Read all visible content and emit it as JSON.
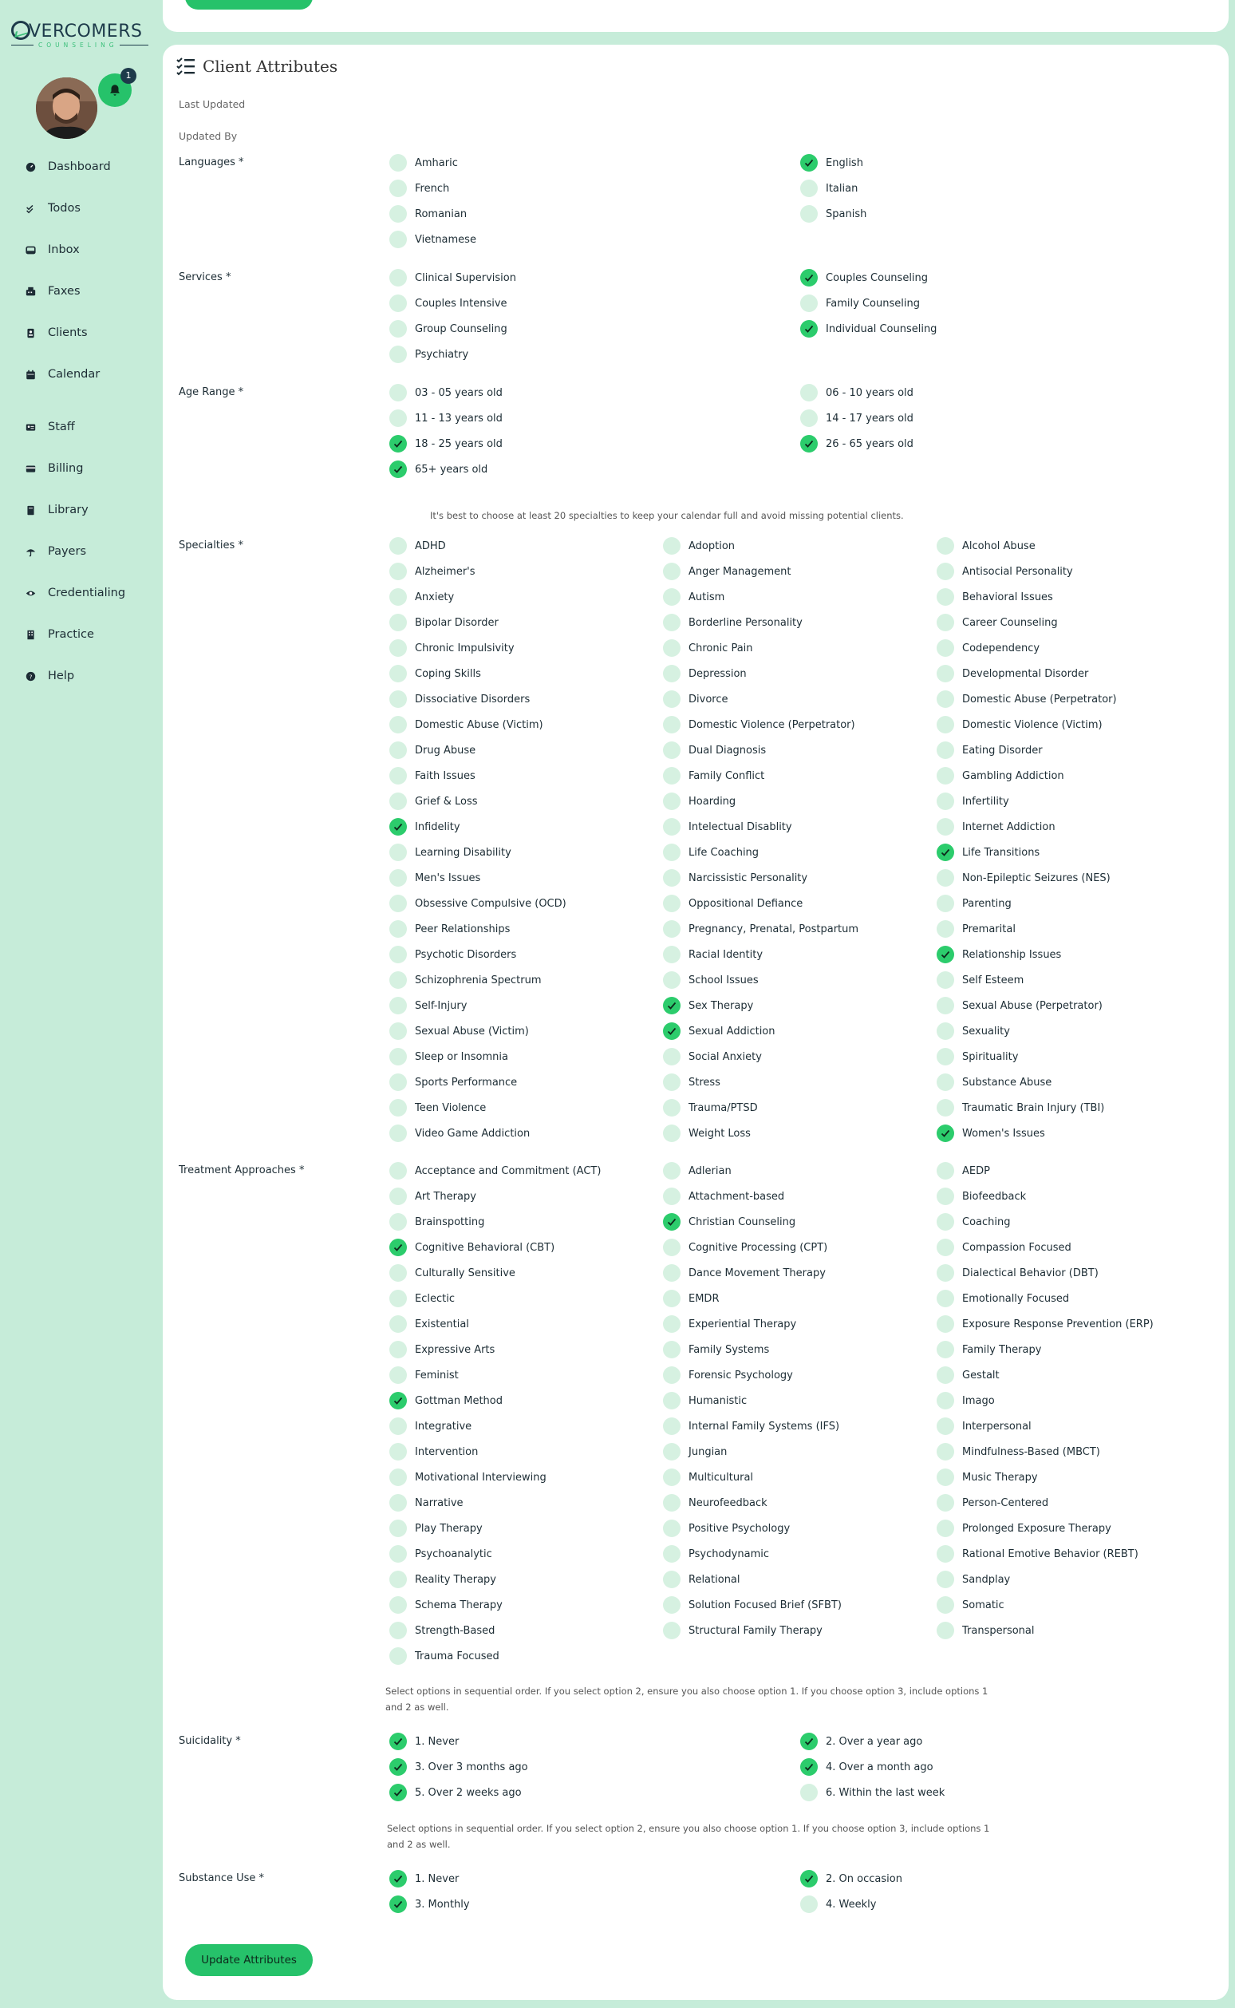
{
  "brand": {
    "logo_main": "VERCOMERS",
    "logo_sub": "COUNSELING"
  },
  "colors": {
    "accent": "#26c26a",
    "background": "#c6ecd9",
    "checkbox_off": "#d6f1e1"
  },
  "notifications": {
    "count": "1"
  },
  "nav": [
    {
      "label": "Dashboard",
      "icon": "dashboard-icon"
    },
    {
      "label": "Todos",
      "icon": "checks-icon"
    },
    {
      "label": "Inbox",
      "icon": "inbox-icon"
    },
    {
      "label": "Faxes",
      "icon": "fax-icon"
    },
    {
      "label": "Clients",
      "icon": "contact-card-icon"
    },
    {
      "label": "Calendar",
      "icon": "calendar-icon"
    },
    {
      "label": "Staff",
      "icon": "id-card-icon"
    },
    {
      "label": "Billing",
      "icon": "billing-icon"
    },
    {
      "label": "Library",
      "icon": "book-icon"
    },
    {
      "label": "Payers",
      "icon": "umbrella-icon"
    },
    {
      "label": "Credentialing",
      "icon": "eye-icon"
    },
    {
      "label": "Practice",
      "icon": "building-icon"
    },
    {
      "label": "Help",
      "icon": "help-icon"
    }
  ],
  "card": {
    "title": "Client Attributes",
    "last_updated_label": "Last Updated",
    "updated_by_label": "Updated By",
    "specialties_hint": "It's best to choose at least 20 specialties to keep your calendar full and avoid missing potential clients.",
    "suicidality_hint_1": "Select options in sequential order. If you select option 2, ensure you also choose option 1. If you choose option 3, include options 1",
    "suicidality_hint_2": "and 2 as well.",
    "substance_hint_1": "Select options in sequential order. If you select option 2, ensure you also choose option 1. If you choose option 3, include options 1",
    "substance_hint_2": "and 2 as well.",
    "update_button": "Update Attributes"
  },
  "sections": [
    {
      "key": "languages",
      "label": "Languages *",
      "cols": 2,
      "options": [
        {
          "label": "Amharic",
          "checked": false
        },
        {
          "label": "English",
          "checked": true
        },
        {
          "label": "French",
          "checked": false
        },
        {
          "label": "Italian",
          "checked": false
        },
        {
          "label": "Romanian",
          "checked": false
        },
        {
          "label": "Spanish",
          "checked": false
        },
        {
          "label": "Vietnamese",
          "checked": false
        }
      ]
    },
    {
      "key": "services",
      "label": "Services *",
      "cols": 2,
      "options": [
        {
          "label": "Clinical Supervision",
          "checked": false
        },
        {
          "label": "Couples Counseling",
          "checked": true
        },
        {
          "label": "Couples Intensive",
          "checked": false
        },
        {
          "label": "Family Counseling",
          "checked": false
        },
        {
          "label": "Group Counseling",
          "checked": false
        },
        {
          "label": "Individual Counseling",
          "checked": true
        },
        {
          "label": "Psychiatry",
          "checked": false
        }
      ]
    },
    {
      "key": "age_range",
      "label": "Age Range *",
      "cols": 2,
      "options": [
        {
          "label": "03 - 05 years old",
          "checked": false
        },
        {
          "label": "06 - 10 years old",
          "checked": false
        },
        {
          "label": "11 - 13 years old",
          "checked": false
        },
        {
          "label": "14 - 17 years old",
          "checked": false
        },
        {
          "label": "18 - 25 years old",
          "checked": true
        },
        {
          "label": "26 - 65 years old",
          "checked": true
        },
        {
          "label": "65+ years old",
          "checked": true
        }
      ]
    },
    {
      "key": "specialties",
      "label": "Specialties *",
      "cols": 3,
      "options": [
        {
          "label": "ADHD",
          "checked": false
        },
        {
          "label": "Adoption",
          "checked": false
        },
        {
          "label": "Alcohol Abuse",
          "checked": false
        },
        {
          "label": "Alzheimer's",
          "checked": false
        },
        {
          "label": "Anger Management",
          "checked": false
        },
        {
          "label": "Antisocial Personality",
          "checked": false
        },
        {
          "label": "Anxiety",
          "checked": false
        },
        {
          "label": "Autism",
          "checked": false
        },
        {
          "label": "Behavioral Issues",
          "checked": false
        },
        {
          "label": "Bipolar Disorder",
          "checked": false
        },
        {
          "label": "Borderline Personality",
          "checked": false
        },
        {
          "label": "Career Counseling",
          "checked": false
        },
        {
          "label": "Chronic Impulsivity",
          "checked": false
        },
        {
          "label": "Chronic Pain",
          "checked": false
        },
        {
          "label": "Codependency",
          "checked": false
        },
        {
          "label": "Coping Skills",
          "checked": false
        },
        {
          "label": "Depression",
          "checked": false
        },
        {
          "label": "Developmental Disorder",
          "checked": false
        },
        {
          "label": "Dissociative Disorders",
          "checked": false
        },
        {
          "label": "Divorce",
          "checked": false
        },
        {
          "label": "Domestic Abuse (Perpetrator)",
          "checked": false
        },
        {
          "label": "Domestic Abuse (Victim)",
          "checked": false
        },
        {
          "label": "Domestic Violence (Perpetrator)",
          "checked": false
        },
        {
          "label": "Domestic Violence (Victim)",
          "checked": false
        },
        {
          "label": "Drug Abuse",
          "checked": false
        },
        {
          "label": "Dual Diagnosis",
          "checked": false
        },
        {
          "label": "Eating Disorder",
          "checked": false
        },
        {
          "label": "Faith Issues",
          "checked": false
        },
        {
          "label": "Family Conflict",
          "checked": false
        },
        {
          "label": "Gambling Addiction",
          "checked": false
        },
        {
          "label": "Grief & Loss",
          "checked": false
        },
        {
          "label": "Hoarding",
          "checked": false
        },
        {
          "label": "Infertility",
          "checked": false
        },
        {
          "label": "Infidelity",
          "checked": true
        },
        {
          "label": "Intelectual Disablity",
          "checked": false
        },
        {
          "label": "Internet Addiction",
          "checked": false
        },
        {
          "label": "Learning Disability",
          "checked": false
        },
        {
          "label": "Life Coaching",
          "checked": false
        },
        {
          "label": "Life Transitions",
          "checked": true
        },
        {
          "label": "Men's Issues",
          "checked": false
        },
        {
          "label": "Narcissistic Personality",
          "checked": false
        },
        {
          "label": "Non-Epileptic Seizures (NES)",
          "checked": false
        },
        {
          "label": "Obsessive Compulsive (OCD)",
          "checked": false
        },
        {
          "label": "Oppositional Defiance",
          "checked": false
        },
        {
          "label": "Parenting",
          "checked": false
        },
        {
          "label": "Peer Relationships",
          "checked": false
        },
        {
          "label": "Pregnancy, Prenatal, Postpartum",
          "checked": false
        },
        {
          "label": "Premarital",
          "checked": false
        },
        {
          "label": "Psychotic Disorders",
          "checked": false
        },
        {
          "label": "Racial Identity",
          "checked": false
        },
        {
          "label": "Relationship Issues",
          "checked": true
        },
        {
          "label": "Schizophrenia Spectrum",
          "checked": false
        },
        {
          "label": "School Issues",
          "checked": false
        },
        {
          "label": "Self Esteem",
          "checked": false
        },
        {
          "label": "Self-Injury",
          "checked": false
        },
        {
          "label": "Sex Therapy",
          "checked": true
        },
        {
          "label": "Sexual Abuse (Perpetrator)",
          "checked": false
        },
        {
          "label": "Sexual Abuse (Victim)",
          "checked": false
        },
        {
          "label": "Sexual Addiction",
          "checked": true
        },
        {
          "label": "Sexuality",
          "checked": false
        },
        {
          "label": "Sleep or Insomnia",
          "checked": false
        },
        {
          "label": "Social Anxiety",
          "checked": false
        },
        {
          "label": "Spirituality",
          "checked": false
        },
        {
          "label": "Sports Performance",
          "checked": false
        },
        {
          "label": "Stress",
          "checked": false
        },
        {
          "label": "Substance Abuse",
          "checked": false
        },
        {
          "label": "Teen Violence",
          "checked": false
        },
        {
          "label": "Trauma/PTSD",
          "checked": false
        },
        {
          "label": "Traumatic Brain Injury (TBI)",
          "checked": false
        },
        {
          "label": "Video Game Addiction",
          "checked": false
        },
        {
          "label": "Weight Loss",
          "checked": false
        },
        {
          "label": "Women's Issues",
          "checked": true
        }
      ]
    },
    {
      "key": "treatment",
      "label": "Treatment Approaches *",
      "cols": 3,
      "options": [
        {
          "label": "Acceptance and Commitment (ACT)",
          "checked": false
        },
        {
          "label": "Adlerian",
          "checked": false
        },
        {
          "label": "AEDP",
          "checked": false
        },
        {
          "label": "Art Therapy",
          "checked": false
        },
        {
          "label": "Attachment-based",
          "checked": false
        },
        {
          "label": "Biofeedback",
          "checked": false
        },
        {
          "label": "Brainspotting",
          "checked": false
        },
        {
          "label": "Christian Counseling",
          "checked": true
        },
        {
          "label": "Coaching",
          "checked": false
        },
        {
          "label": "Cognitive Behavioral (CBT)",
          "checked": true
        },
        {
          "label": "Cognitive Processing (CPT)",
          "checked": false
        },
        {
          "label": "Compassion Focused",
          "checked": false
        },
        {
          "label": "Culturally Sensitive",
          "checked": false
        },
        {
          "label": "Dance Movement Therapy",
          "checked": false
        },
        {
          "label": "Dialectical Behavior (DBT)",
          "checked": false
        },
        {
          "label": "Eclectic",
          "checked": false
        },
        {
          "label": "EMDR",
          "checked": false
        },
        {
          "label": "Emotionally Focused",
          "checked": false
        },
        {
          "label": "Existential",
          "checked": false
        },
        {
          "label": "Experiential Therapy",
          "checked": false
        },
        {
          "label": "Exposure Response Prevention (ERP)",
          "checked": false
        },
        {
          "label": "Expressive Arts",
          "checked": false
        },
        {
          "label": "Family Systems",
          "checked": false
        },
        {
          "label": "Family Therapy",
          "checked": false
        },
        {
          "label": "Feminist",
          "checked": false
        },
        {
          "label": "Forensic Psychology",
          "checked": false
        },
        {
          "label": "Gestalt",
          "checked": false
        },
        {
          "label": "Gottman Method",
          "checked": true
        },
        {
          "label": "Humanistic",
          "checked": false
        },
        {
          "label": "Imago",
          "checked": false
        },
        {
          "label": "Integrative",
          "checked": false
        },
        {
          "label": "Internal Family Systems (IFS)",
          "checked": false
        },
        {
          "label": "Interpersonal",
          "checked": false
        },
        {
          "label": "Intervention",
          "checked": false
        },
        {
          "label": "Jungian",
          "checked": false
        },
        {
          "label": "Mindfulness-Based (MBCT)",
          "checked": false
        },
        {
          "label": "Motivational Interviewing",
          "checked": false
        },
        {
          "label": "Multicultural",
          "checked": false
        },
        {
          "label": "Music Therapy",
          "checked": false
        },
        {
          "label": "Narrative",
          "checked": false
        },
        {
          "label": "Neurofeedback",
          "checked": false
        },
        {
          "label": "Person-Centered",
          "checked": false
        },
        {
          "label": "Play Therapy",
          "checked": false
        },
        {
          "label": "Positive Psychology",
          "checked": false
        },
        {
          "label": "Prolonged Exposure Therapy",
          "checked": false
        },
        {
          "label": "Psychoanalytic",
          "checked": false
        },
        {
          "label": "Psychodynamic",
          "checked": false
        },
        {
          "label": "Rational Emotive Behavior (REBT)",
          "checked": false
        },
        {
          "label": "Reality Therapy",
          "checked": false
        },
        {
          "label": "Relational",
          "checked": false
        },
        {
          "label": "Sandplay",
          "checked": false
        },
        {
          "label": "Schema Therapy",
          "checked": false
        },
        {
          "label": "Solution Focused Brief (SFBT)",
          "checked": false
        },
        {
          "label": "Somatic",
          "checked": false
        },
        {
          "label": "Strength-Based",
          "checked": false
        },
        {
          "label": "Structural Family Therapy",
          "checked": false
        },
        {
          "label": "Transpersonal",
          "checked": false
        },
        {
          "label": "Trauma Focused",
          "checked": false
        }
      ]
    },
    {
      "key": "suicidality",
      "label": "Suicidality *",
      "cols": 2,
      "options": [
        {
          "label": "1. Never",
          "checked": true
        },
        {
          "label": "2. Over a year ago",
          "checked": true
        },
        {
          "label": "3. Over 3 months ago",
          "checked": true
        },
        {
          "label": "4. Over a month ago",
          "checked": true
        },
        {
          "label": "5. Over 2 weeks ago",
          "checked": true
        },
        {
          "label": "6. Within the last week",
          "checked": false
        }
      ]
    },
    {
      "key": "substance",
      "label": "Substance Use *",
      "cols": 2,
      "options": [
        {
          "label": "1. Never",
          "checked": true
        },
        {
          "label": "2. On occasion",
          "checked": true
        },
        {
          "label": "3. Monthly",
          "checked": true
        },
        {
          "label": "4. Weekly",
          "checked": false
        }
      ]
    }
  ]
}
